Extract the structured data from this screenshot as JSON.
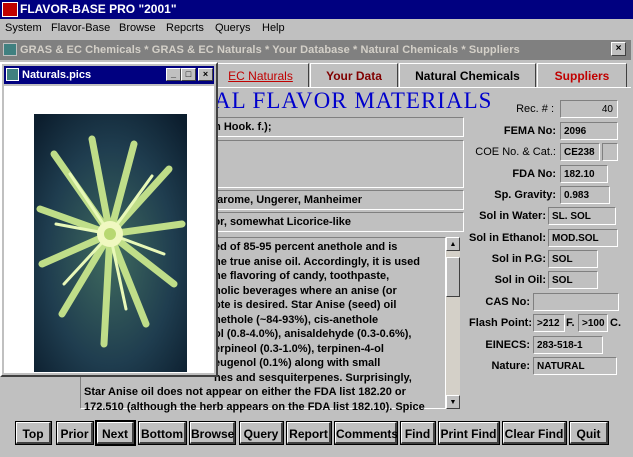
{
  "app": {
    "title": "FLAVOR-BASE PRO \"2001\""
  },
  "menu": [
    "System",
    "Flavor-Base",
    "Browse",
    "Repcrts",
    "Querys",
    "Help"
  ],
  "child_window": {
    "title": "GRAS & EC Chemicals * GRAS & EC Naturals * Your Database * Natural Chemicals * Suppliers",
    "close": "×"
  },
  "tabs": [
    {
      "label": "EC Naturals",
      "color": "#c00000"
    },
    {
      "label": "Your Data",
      "color": "#800000"
    },
    {
      "label": "Natural Chemicals",
      "color": "#000000"
    },
    {
      "label": "Suppliers",
      "color": "#c00000"
    }
  ],
  "page": {
    "title_fragment": "AL FLAVOR MATERIALS"
  },
  "record": {
    "botanical_fragment": "rum Hook. f.);",
    "suppliers_fragment": "Polarome, Ungerer, Manheimer",
    "odor_fragment": "odor, somewhat Licorice-like",
    "description_lines": [
      "ed of 85-95 percent anethole and is",
      "he true anise oil.  Accordingly, it is used",
      "he flavoring of candy, toothpaste,",
      "holic beverages where an anise (or",
      "ote is desired.  Star Anise (seed) oil",
      "nethole (~84-93%), cis-anethole",
      "ol (0.8-4.0%), anisaldehyde (0.3-0.6%),",
      "erpineol (0.3-1.0%), terpinen-4-ol",
      "eugenol (0.1%) along with small",
      "nes and sesquiterpenes.  Surprisingly,",
      "Star Anise oil does not appear on either the FDA list 182.20 or",
      "172.510 (although the herb appears on the FDA list 182.10).  Spice"
    ]
  },
  "props": {
    "rec_label": "Rec. # :",
    "rec_value": "40",
    "fema_label": "FEMA No:",
    "fema_value": "2096",
    "coe_label": "COE No. & Cat.:",
    "coe_value": "CE238",
    "coe_cat": "",
    "fda_label": "FDA No:",
    "fda_value": "182.10",
    "sg_label": "Sp. Gravity:",
    "sg_value": "0.983",
    "water_label": "Sol in Water:",
    "water_value": "SL. SOL",
    "ethanol_label": "Sol in Ethanol:",
    "ethanol_value": "MOD.SOL",
    "pg_label": "Sol in P.G:",
    "pg_value": "SOL",
    "oil_label": "Sol in Oil:",
    "oil_value": "SOL",
    "cas_label": "CAS No:",
    "cas_value": "",
    "flash_label": "Flash Point:",
    "flash_f_value": ">212",
    "flash_f_unit": "F.",
    "flash_c_value": ">100",
    "flash_c_unit": "C.",
    "einecs_label": "EINECS:",
    "einecs_value": "283-518-1",
    "nature_label": "Nature:",
    "nature_value": "NATURAL"
  },
  "pic_window": {
    "title": "Naturals.pics",
    "min": "_",
    "max": "□",
    "close": "×"
  },
  "buttons": {
    "top": "Top",
    "prior": "Prior",
    "next": "Next",
    "bottom": "Bottom",
    "browse": "Browse",
    "query": "Query",
    "report": "Report",
    "comments": "Comments",
    "find": "Find",
    "print_find": "Print Find",
    "clear_find": "Clear Find",
    "quit": "Quit"
  }
}
